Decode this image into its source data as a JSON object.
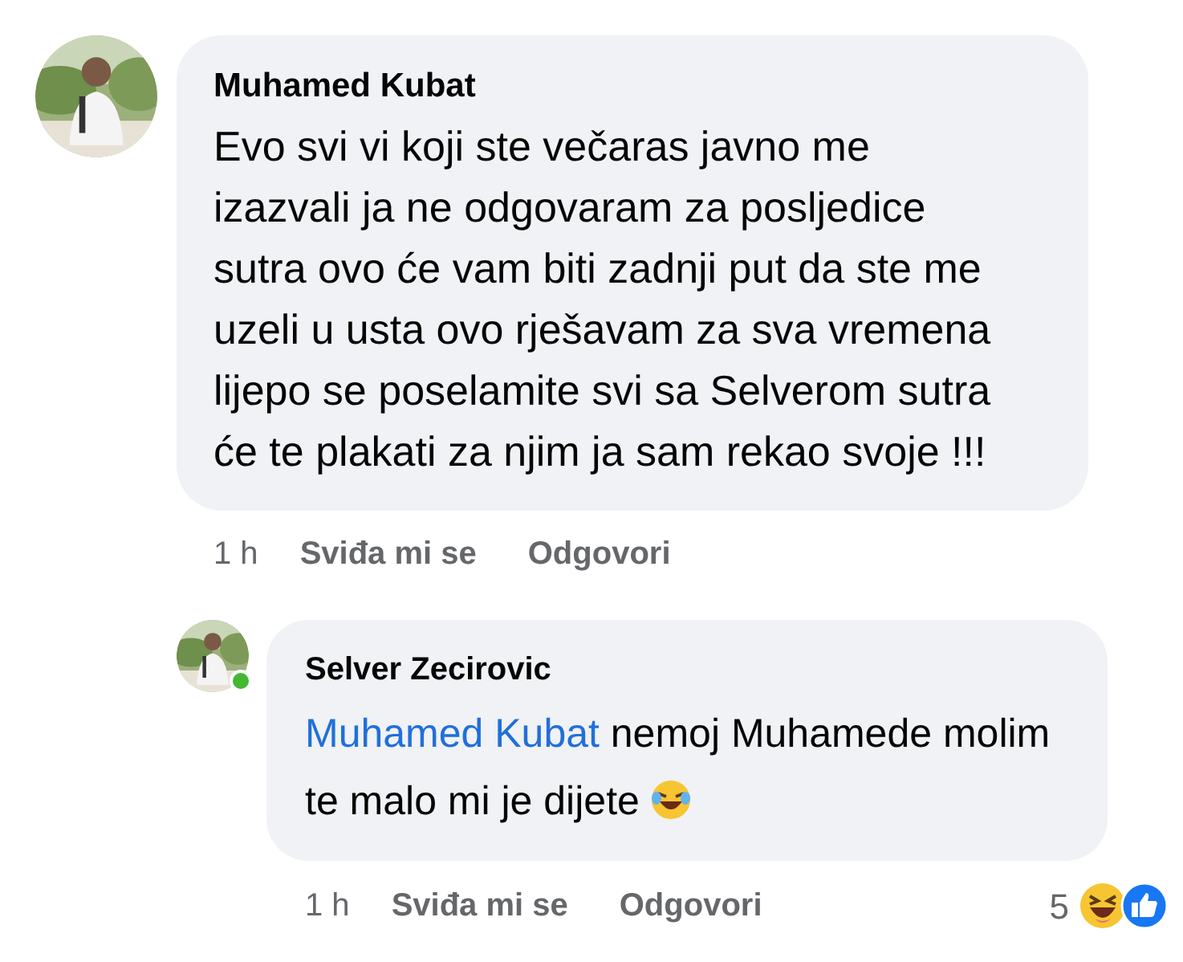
{
  "comment": {
    "author": "Muhamed Kubat",
    "text": "Evo svi vi koji ste večaras javno me izazvali ja ne odgovaram za posljedice sutra ovo će vam biti zadnji put da ste me uzeli u usta ovo rješavam za sva vremena lijepo se poselamite svi sa Selverom sutra će te plakati za njim ja sam rekao svoje !!!",
    "time": "1 h",
    "actions": [
      "Sviđa mi se",
      "Odgovori"
    ]
  },
  "reply": {
    "author": "Selver Zecirovic",
    "mention": "Muhamed Kubat",
    "text": "nemoj Muhamede molim te malo mi je dijete",
    "time": "1 h",
    "actions": [
      "Sviđa mi se",
      "Odgovori"
    ],
    "online": true,
    "reactions": {
      "count": "5"
    }
  }
}
